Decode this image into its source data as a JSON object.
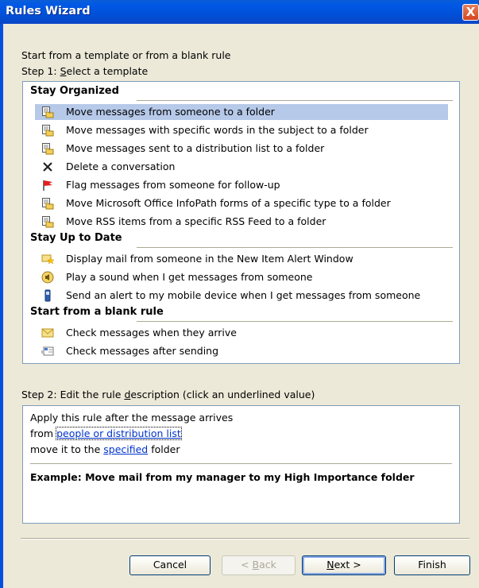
{
  "window": {
    "title": "Rules Wizard",
    "close_glyph": "X"
  },
  "intro": "Start from a template or from a blank rule",
  "step1": {
    "prefix": "Step 1: ",
    "accel": "S",
    "rest": "elect a template"
  },
  "groups": [
    {
      "title": "Stay Organized",
      "items": [
        {
          "label": "Move messages from someone to a folder",
          "icon": "move-folder-icon",
          "selected": true
        },
        {
          "label": "Move messages with specific words in the subject to a folder",
          "icon": "move-folder-icon"
        },
        {
          "label": "Move messages sent to a distribution list to a folder",
          "icon": "move-folder-icon"
        },
        {
          "label": "Delete a conversation",
          "icon": "delete-x-icon"
        },
        {
          "label": "Flag messages from someone for follow-up",
          "icon": "flag-icon"
        },
        {
          "label": "Move Microsoft Office InfoPath forms of a specific type to a folder",
          "icon": "move-folder-icon"
        },
        {
          "label": "Move RSS items from a specific RSS Feed to a folder",
          "icon": "move-folder-icon"
        }
      ]
    },
    {
      "title": "Stay Up to Date",
      "items": [
        {
          "label": "Display mail from someone in the New Item Alert Window",
          "icon": "alert-star-icon"
        },
        {
          "label": "Play a sound when I get messages from someone",
          "icon": "speaker-icon"
        },
        {
          "label": "Send an alert to my mobile device when I get messages from someone",
          "icon": "mobile-phone-icon"
        }
      ]
    },
    {
      "title": "Start from a blank rule",
      "items": [
        {
          "label": "Check messages when they arrive",
          "icon": "envelope-icon"
        },
        {
          "label": "Check messages after sending",
          "icon": "sent-mail-icon"
        }
      ]
    }
  ],
  "step2": {
    "prefix": "Step 2: Edit the rule ",
    "accel": "d",
    "rest": "escription (click an underlined value)"
  },
  "description": {
    "line1": "Apply this rule after the message arrives",
    "line2_prefix": "from ",
    "line2_link": "people or distribution list",
    "line3_prefix": "move it to the ",
    "line3_link": "specified",
    "line3_suffix": " folder",
    "example": "Example: Move mail from my manager to my High Importance folder"
  },
  "buttons": {
    "cancel": "Cancel",
    "back_prefix": "< ",
    "back_accel": "B",
    "back_rest": "ack",
    "next_accel": "N",
    "next_rest": "ext >",
    "finish": "Finish"
  },
  "colors": {
    "accent": "#0450e1",
    "selection": "#b6c9e9",
    "link": "#0033cc"
  }
}
